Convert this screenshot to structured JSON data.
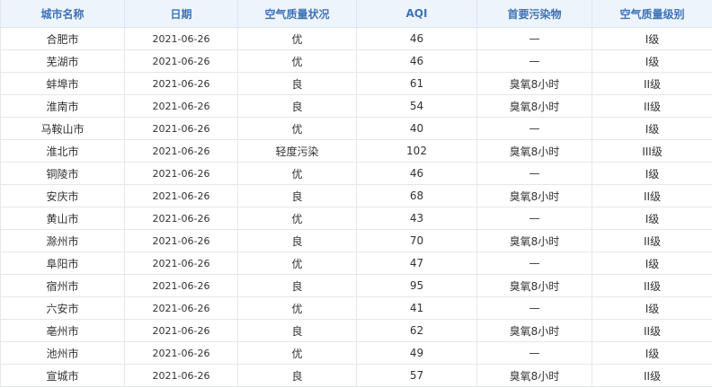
{
  "table": {
    "headers": [
      "城市名称",
      "日期",
      "空气质量状况",
      "AQI",
      "首要污染物",
      "空气质量级别"
    ],
    "rows": [
      {
        "city": "合肥市",
        "date": "2021-06-26",
        "status": "优",
        "aqi": "46",
        "pollutant": "—",
        "level": "I级"
      },
      {
        "city": "芜湖市",
        "date": "2021-06-26",
        "status": "优",
        "aqi": "46",
        "pollutant": "—",
        "level": "I级"
      },
      {
        "city": "蚌埠市",
        "date": "2021-06-26",
        "status": "良",
        "aqi": "61",
        "pollutant": "臭氧8小时",
        "level": "II级"
      },
      {
        "city": "淮南市",
        "date": "2021-06-26",
        "status": "良",
        "aqi": "54",
        "pollutant": "臭氧8小时",
        "level": "II级"
      },
      {
        "city": "马鞍山市",
        "date": "2021-06-26",
        "status": "优",
        "aqi": "40",
        "pollutant": "—",
        "level": "I级"
      },
      {
        "city": "淮北市",
        "date": "2021-06-26",
        "status": "轻度污染",
        "aqi": "102",
        "pollutant": "臭氧8小时",
        "level": "III级"
      },
      {
        "city": "铜陵市",
        "date": "2021-06-26",
        "status": "优",
        "aqi": "46",
        "pollutant": "—",
        "level": "I级"
      },
      {
        "city": "安庆市",
        "date": "2021-06-26",
        "status": "良",
        "aqi": "68",
        "pollutant": "臭氧8小时",
        "level": "II级"
      },
      {
        "city": "黄山市",
        "date": "2021-06-26",
        "status": "优",
        "aqi": "43",
        "pollutant": "—",
        "level": "I级"
      },
      {
        "city": "滁州市",
        "date": "2021-06-26",
        "status": "良",
        "aqi": "70",
        "pollutant": "臭氧8小时",
        "level": "II级"
      },
      {
        "city": "阜阳市",
        "date": "2021-06-26",
        "status": "优",
        "aqi": "47",
        "pollutant": "—",
        "level": "I级"
      },
      {
        "city": "宿州市",
        "date": "2021-06-26",
        "status": "良",
        "aqi": "95",
        "pollutant": "臭氧8小时",
        "level": "II级"
      },
      {
        "city": "六安市",
        "date": "2021-06-26",
        "status": "优",
        "aqi": "41",
        "pollutant": "—",
        "level": "I级"
      },
      {
        "city": "亳州市",
        "date": "2021-06-26",
        "status": "良",
        "aqi": "62",
        "pollutant": "臭氧8小时",
        "level": "II级"
      },
      {
        "city": "池州市",
        "date": "2021-06-26",
        "status": "优",
        "aqi": "49",
        "pollutant": "—",
        "level": "I级"
      },
      {
        "city": "宣城市",
        "date": "2021-06-26",
        "status": "良",
        "aqi": "57",
        "pollutant": "臭氧8小时",
        "level": "II级"
      }
    ]
  },
  "colors": {
    "header_text": "#3d73b8",
    "header_background": "#eef4fb",
    "border": "#e3e8ee"
  }
}
